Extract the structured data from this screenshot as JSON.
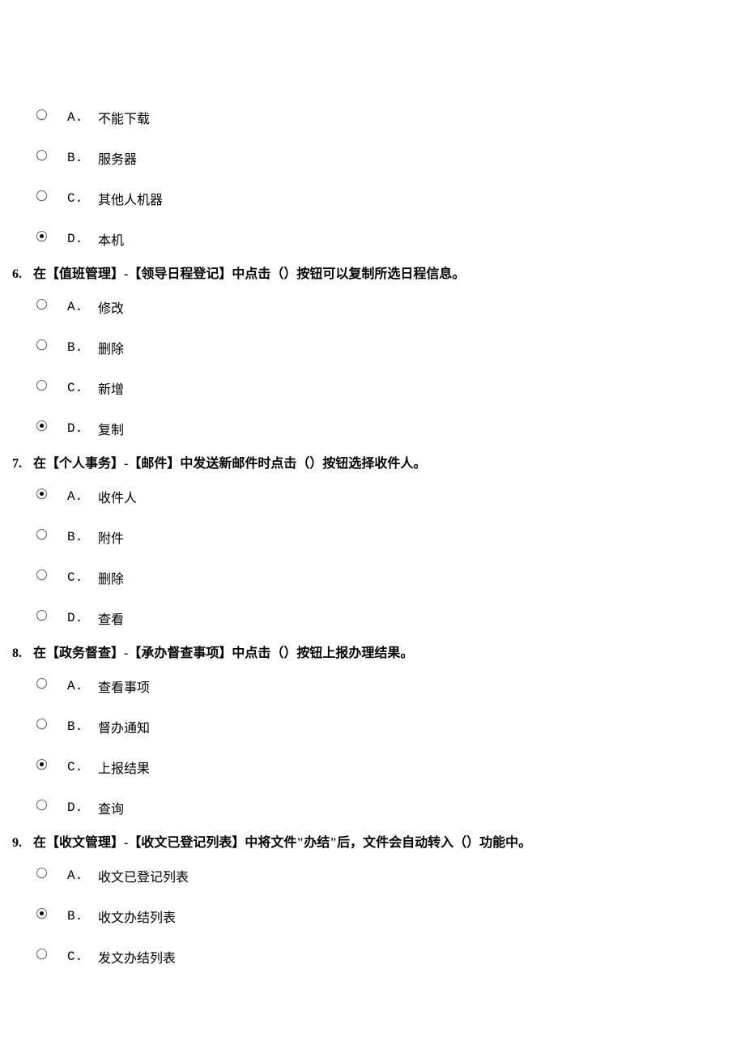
{
  "questions": [
    {
      "number": "",
      "text": "",
      "show_header": false,
      "options": [
        {
          "letter": "A.",
          "text": "不能下载",
          "selected": false
        },
        {
          "letter": "B.",
          "text": "服务器",
          "selected": false
        },
        {
          "letter": "C.",
          "text": "其他人机器",
          "selected": false
        },
        {
          "letter": "D.",
          "text": "本机",
          "selected": true
        }
      ]
    },
    {
      "number": "6.",
      "text": "在【值班管理】-【领导日程登记】中点击（）按钮可以复制所选日程信息。",
      "show_header": true,
      "options": [
        {
          "letter": "A.",
          "text": "修改",
          "selected": false
        },
        {
          "letter": "B.",
          "text": "删除",
          "selected": false
        },
        {
          "letter": "C.",
          "text": "新增",
          "selected": false
        },
        {
          "letter": "D.",
          "text": "复制",
          "selected": true
        }
      ]
    },
    {
      "number": "7.",
      "text": "在【个人事务】-【邮件】中发送新邮件时点击（）按钮选择收件人。",
      "show_header": true,
      "options": [
        {
          "letter": "A.",
          "text": "收件人",
          "selected": true
        },
        {
          "letter": "B.",
          "text": "附件",
          "selected": false
        },
        {
          "letter": "C.",
          "text": "删除",
          "selected": false
        },
        {
          "letter": "D.",
          "text": "查看",
          "selected": false
        }
      ]
    },
    {
      "number": "8.",
      "text": "在【政务督查】-【承办督查事项】中点击（）按钮上报办理结果。",
      "show_header": true,
      "options": [
        {
          "letter": "A.",
          "text": "查看事项",
          "selected": false
        },
        {
          "letter": "B.",
          "text": "督办通知",
          "selected": false
        },
        {
          "letter": "C.",
          "text": "上报结果",
          "selected": true
        },
        {
          "letter": "D.",
          "text": "查询",
          "selected": false
        }
      ]
    },
    {
      "number": "9.",
      "text": "在【收文管理】-【收文已登记列表】中将文件\"办结\"后，文件会自动转入（）功能中。",
      "show_header": true,
      "options": [
        {
          "letter": "A.",
          "text": "收文已登记列表",
          "selected": false
        },
        {
          "letter": "B.",
          "text": "收文办结列表",
          "selected": true
        },
        {
          "letter": "C.",
          "text": "发文办结列表",
          "selected": false
        }
      ]
    }
  ]
}
